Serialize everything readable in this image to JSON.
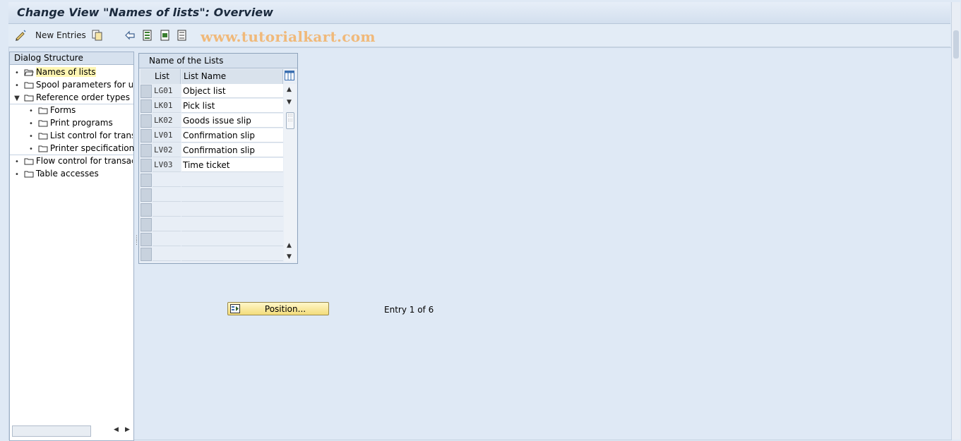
{
  "window": {
    "title": "Change View \"Names of lists\": Overview"
  },
  "toolbar": {
    "new_entries_label": "New Entries",
    "icons": [
      "edit-pencil-icon",
      "copy-icon",
      "undo-icon",
      "select-all-icon",
      "select-block-icon",
      "deselect-icon"
    ],
    "watermark": "www.tutorialkart.com"
  },
  "dialog_structure": {
    "header": "Dialog Structure",
    "items": [
      {
        "label": "Names of lists",
        "level": 0,
        "expander": "bullet",
        "selected": true
      },
      {
        "label": "Spool parameters for use",
        "level": 0,
        "expander": "bullet",
        "selected": false
      },
      {
        "label": "Reference order types",
        "level": 0,
        "expander": "expanded",
        "selected": false
      },
      {
        "label": "Forms",
        "level": 1,
        "expander": "bullet",
        "selected": false
      },
      {
        "label": "Print programs",
        "level": 1,
        "expander": "bullet",
        "selected": false
      },
      {
        "label": "List control for transa",
        "level": 1,
        "expander": "bullet",
        "selected": false
      },
      {
        "label": "Printer specification",
        "level": 1,
        "expander": "bullet",
        "selected": false
      },
      {
        "label": "Flow control for transact",
        "level": 0,
        "expander": "bullet",
        "selected": false
      },
      {
        "label": "Table accesses",
        "level": 0,
        "expander": "bullet",
        "selected": false
      }
    ]
  },
  "table": {
    "caption": "Name of the Lists",
    "columns": [
      "List",
      "List Name"
    ],
    "rows": [
      {
        "list": "LG01",
        "name": "Object list"
      },
      {
        "list": "LK01",
        "name": "Pick list"
      },
      {
        "list": "LK02",
        "name": "Goods issue slip"
      },
      {
        "list": "LV01",
        "name": "Confirmation slip"
      },
      {
        "list": "LV02",
        "name": "Confirmation slip"
      },
      {
        "list": "LV03",
        "name": "Time ticket"
      }
    ],
    "empty_rows": 6
  },
  "position_button": {
    "label": "Position..."
  },
  "entry_info": "Entry 1 of 6",
  "colors": {
    "selection_yellow": "#fff6b3",
    "button_yellow": "#f3dc7a",
    "background": "#dfe9f5"
  }
}
